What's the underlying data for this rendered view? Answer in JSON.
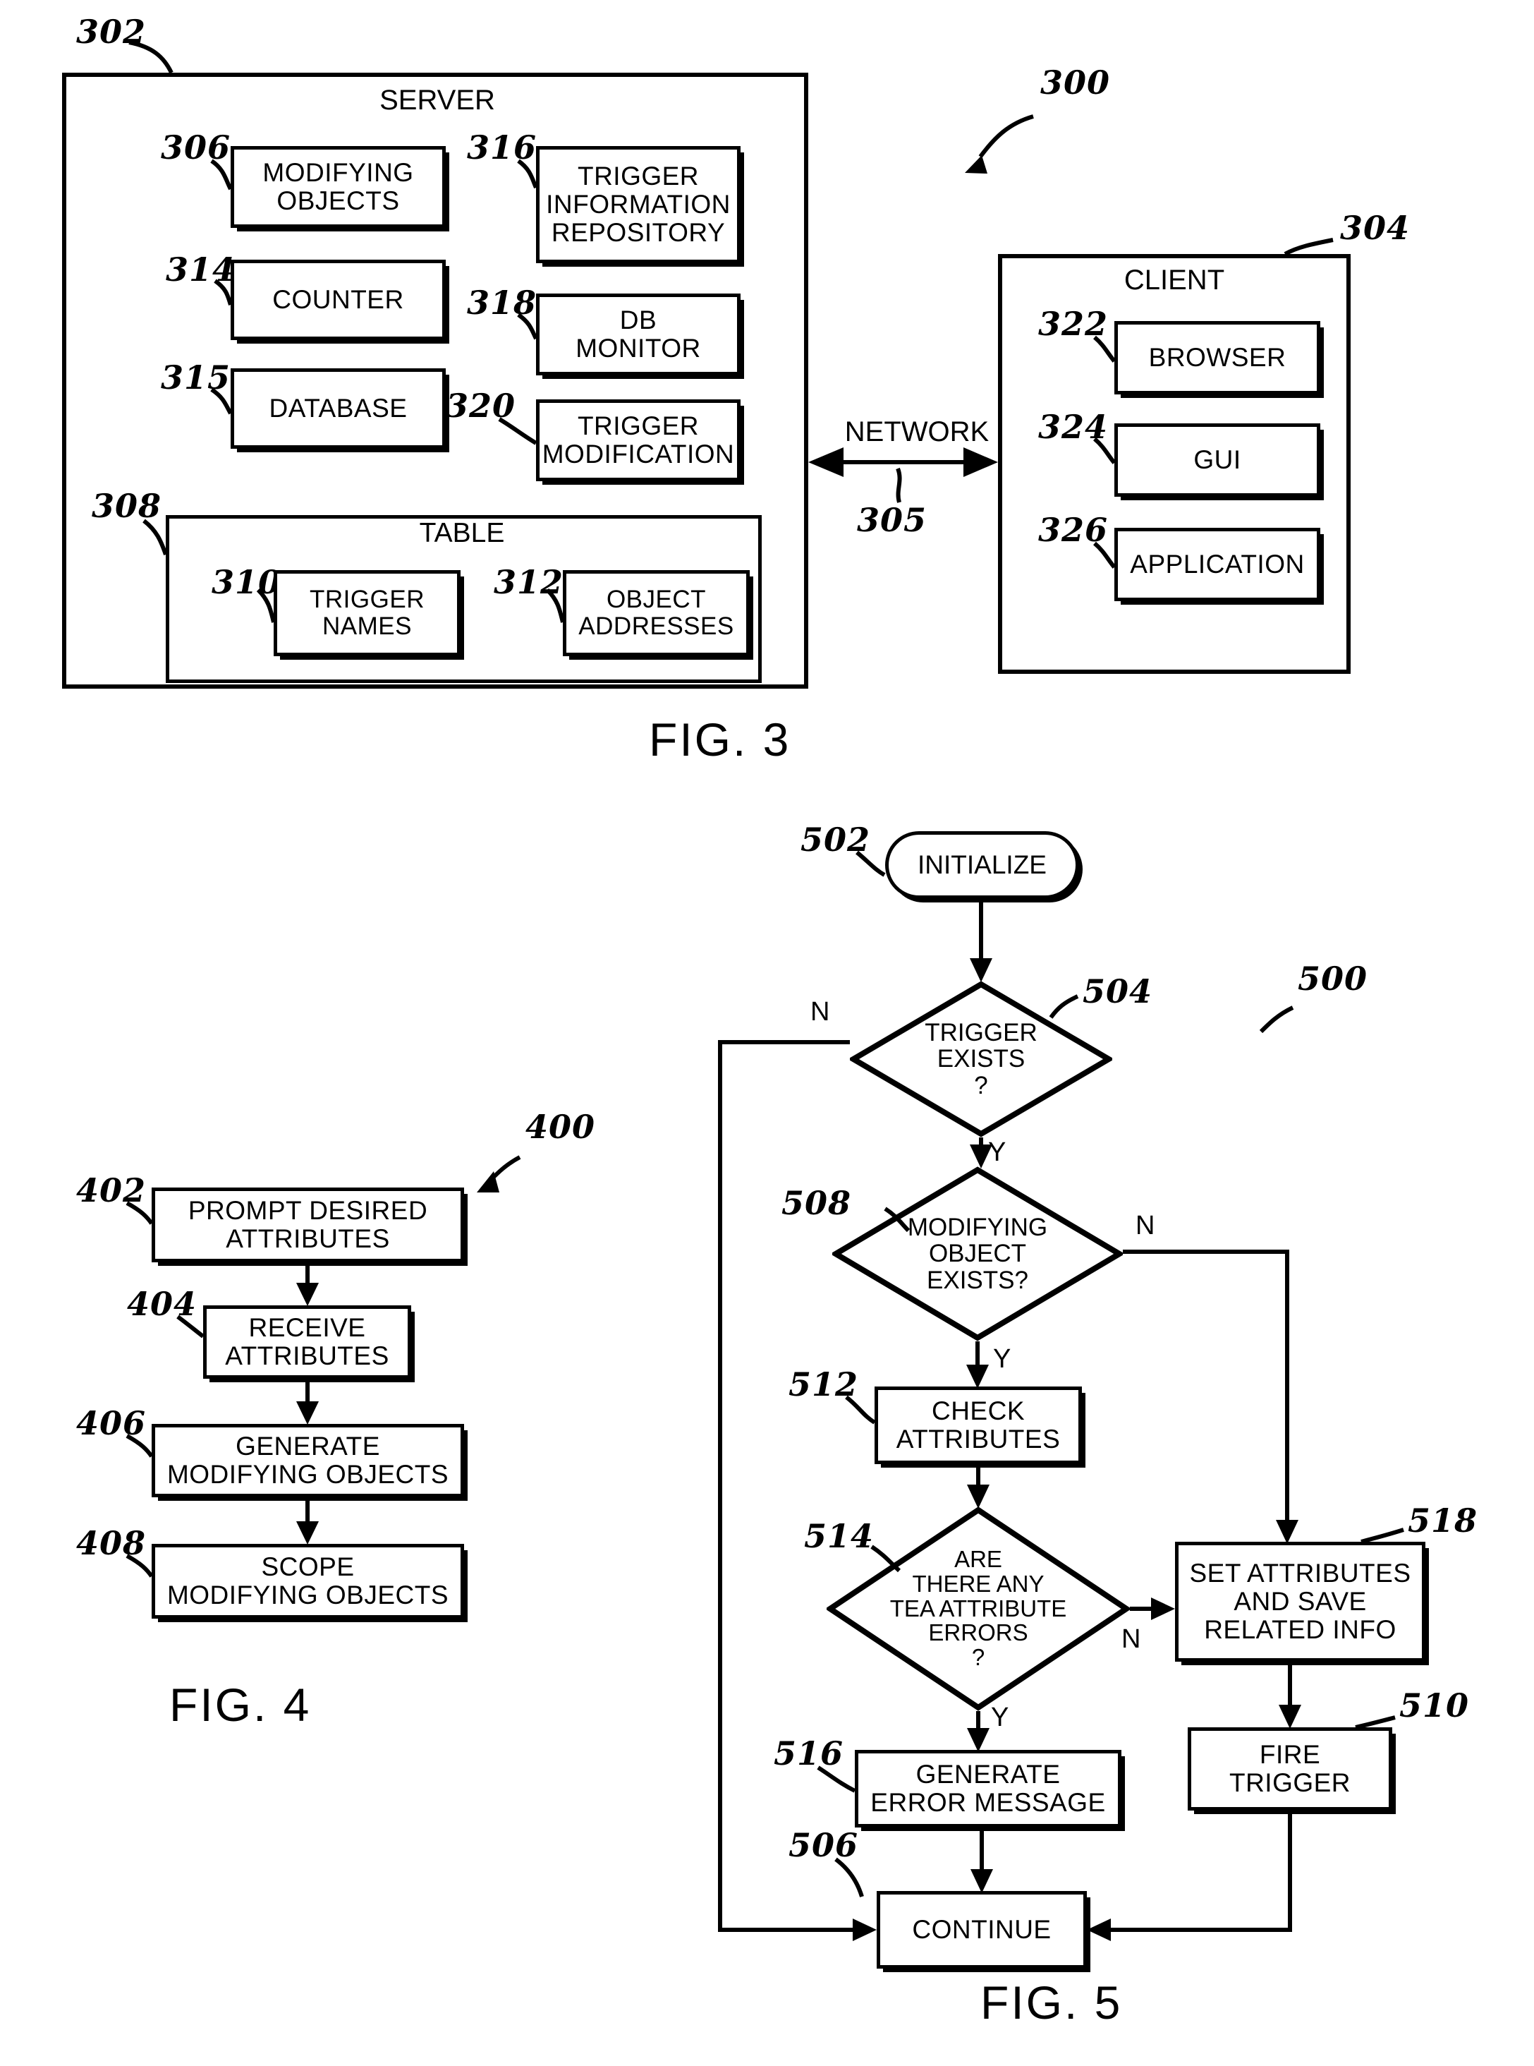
{
  "figures": [
    {
      "id": "fig3",
      "caption": "FIG. 3",
      "system_ref": "300",
      "server": {
        "ref": "302",
        "title": "SERVER",
        "left_column": [
          {
            "ref": "306",
            "label": "MODIFYING\nOBJECTS"
          },
          {
            "ref": "314",
            "label": "COUNTER"
          },
          {
            "ref": "315",
            "label": "DATABASE"
          }
        ],
        "right_column": [
          {
            "ref": "316",
            "label": "TRIGGER\nINFORMATION\nREPOSITORY"
          },
          {
            "ref": "318",
            "label": "DB\nMONITOR"
          },
          {
            "ref": "320",
            "label": "TRIGGER\nMODIFICATION"
          }
        ],
        "table": {
          "ref": "308",
          "title": "TABLE",
          "columns": [
            {
              "ref": "310",
              "label": "TRIGGER\nNAMES"
            },
            {
              "ref": "312",
              "label": "OBJECT\nADDRESSES"
            }
          ]
        }
      },
      "network": {
        "ref": "305",
        "label": "NETWORK"
      },
      "client": {
        "ref": "304",
        "title": "CLIENT",
        "items": [
          {
            "ref": "322",
            "label": "BROWSER"
          },
          {
            "ref": "324",
            "label": "GUI"
          },
          {
            "ref": "326",
            "label": "APPLICATION"
          }
        ]
      }
    },
    {
      "id": "fig4",
      "caption": "FIG. 4",
      "process_ref": "400",
      "steps": [
        {
          "ref": "402",
          "label": "PROMPT DESIRED\nATTRIBUTES"
        },
        {
          "ref": "404",
          "label": "RECEIVE\nATTRIBUTES"
        },
        {
          "ref": "406",
          "label": "GENERATE\nMODIFYING OBJECTS"
        },
        {
          "ref": "408",
          "label": "SCOPE\nMODIFYING OBJECTS"
        }
      ]
    },
    {
      "id": "fig5",
      "caption": "FIG. 5",
      "process_ref": "500",
      "nodes": [
        {
          "ref": "502",
          "type": "terminator",
          "label": "INITIALIZE"
        },
        {
          "ref": "504",
          "type": "decision",
          "label": "TRIGGER\nEXISTS\n?"
        },
        {
          "ref": "508",
          "type": "decision",
          "label": "MODIFYING\nOBJECT\nEXISTS?"
        },
        {
          "ref": "512",
          "type": "process",
          "label": "CHECK\nATTRIBUTES"
        },
        {
          "ref": "514",
          "type": "decision",
          "label": "ARE\nTHERE ANY\nTEA ATTRIBUTE\nERRORS\n?"
        },
        {
          "ref": "516",
          "type": "process",
          "label": "GENERATE\nERROR MESSAGE"
        },
        {
          "ref": "518",
          "type": "process",
          "label": "SET ATTRIBUTES\nAND SAVE\nRELATED INFO"
        },
        {
          "ref": "510",
          "type": "process",
          "label": "FIRE\nTRIGGER"
        },
        {
          "ref": "506",
          "type": "process",
          "label": "CONTINUE"
        }
      ],
      "branch_labels": {
        "trigger_exists_no": "N",
        "trigger_exists_yes": "Y",
        "modifying_object_no": "N",
        "modifying_object_yes": "Y",
        "tea_errors_no": "N",
        "tea_errors_yes": "Y"
      }
    }
  ]
}
